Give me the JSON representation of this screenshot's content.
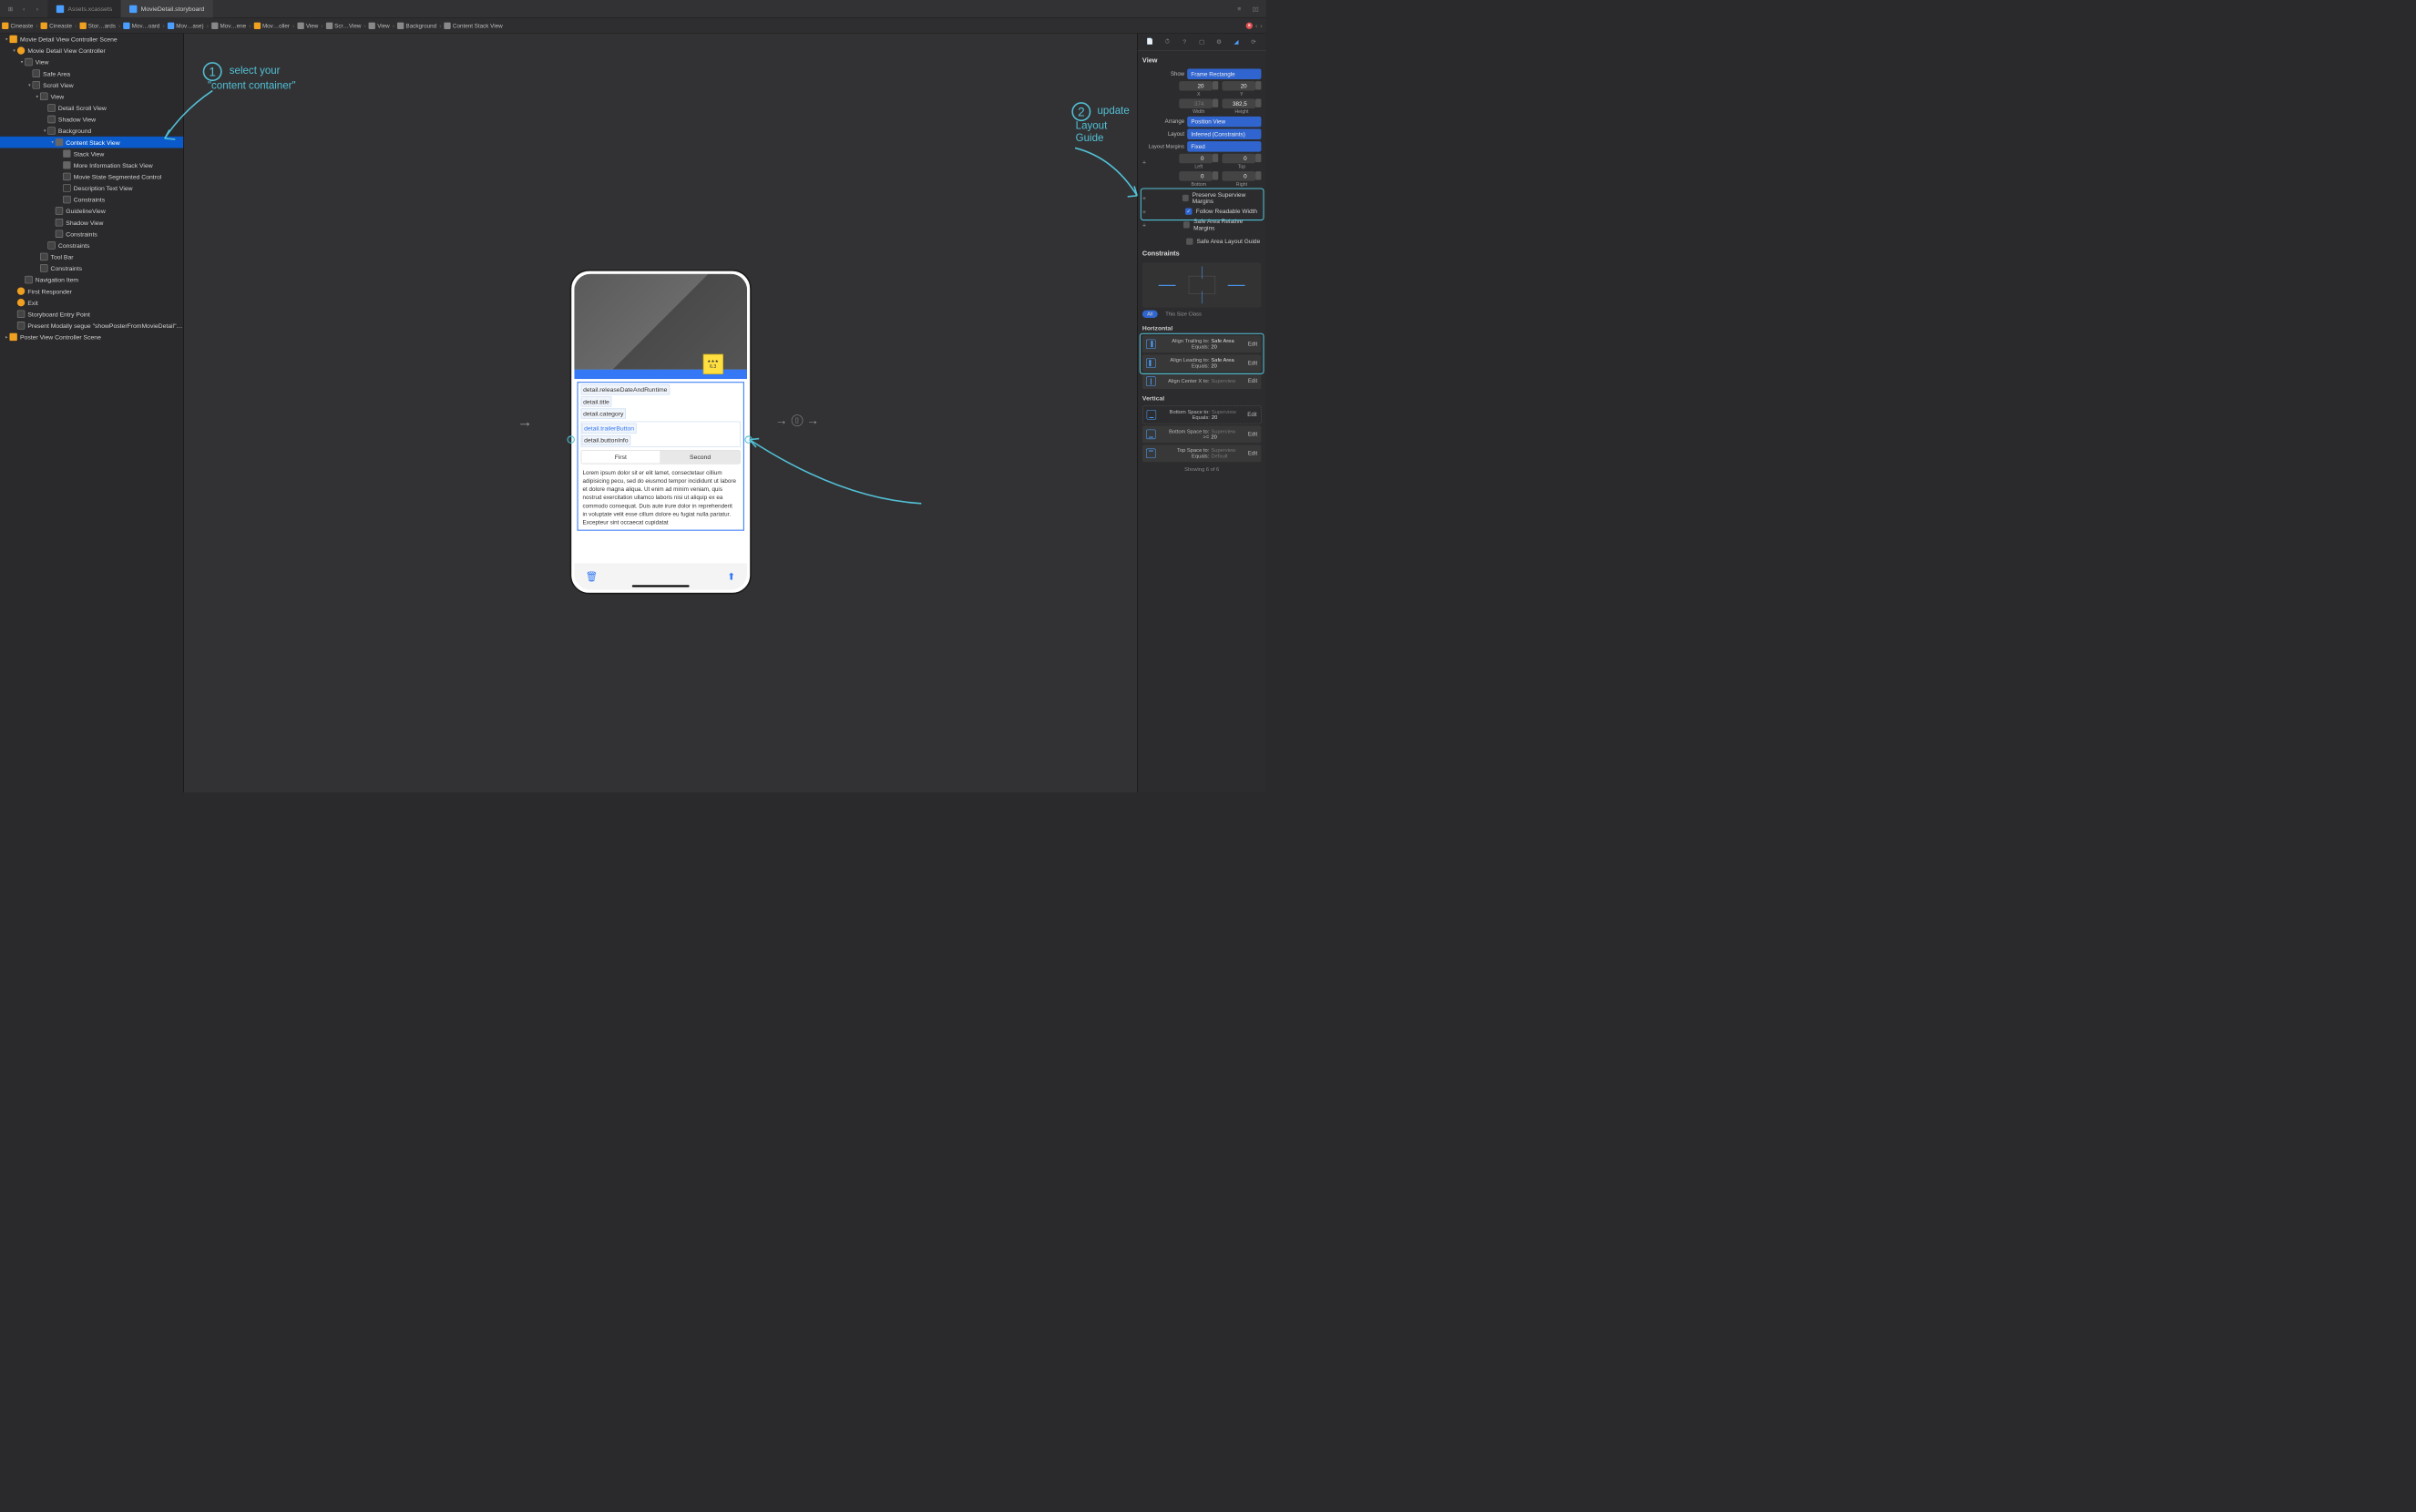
{
  "topbar": {
    "tabs": [
      {
        "label": "Assets.xcassets",
        "active": false
      },
      {
        "label": "MovieDetail.storyboard",
        "active": true
      }
    ]
  },
  "breadcrumb": [
    "Cineaste",
    "Cineaste",
    "Stor…ards",
    "Mov…oard",
    "Mov…ase)",
    "Mov…ene",
    "Mov…oller",
    "View",
    "Scr…View",
    "View",
    "Background",
    "Content Stack View"
  ],
  "outline": [
    {
      "depth": 0,
      "label": "Movie Detail View Controller Scene",
      "icon": "scene",
      "open": true
    },
    {
      "depth": 1,
      "label": "Movie Detail View Controller",
      "icon": "vc",
      "open": true
    },
    {
      "depth": 2,
      "label": "View",
      "icon": "view",
      "open": true
    },
    {
      "depth": 3,
      "label": "Safe Area",
      "icon": "view",
      "leaf": true
    },
    {
      "depth": 3,
      "label": "Scroll View",
      "icon": "view",
      "open": true
    },
    {
      "depth": 4,
      "label": "View",
      "icon": "view",
      "open": true
    },
    {
      "depth": 5,
      "label": "Detail Scroll View",
      "icon": "view",
      "leaf": true
    },
    {
      "depth": 5,
      "label": "Shadow View",
      "icon": "view",
      "leaf": true
    },
    {
      "depth": 5,
      "label": "Background",
      "icon": "view",
      "open": true
    },
    {
      "depth": 6,
      "label": "Content Stack View",
      "icon": "stack",
      "open": true,
      "selected": true
    },
    {
      "depth": 7,
      "label": "Stack View",
      "icon": "stack",
      "leaf": true
    },
    {
      "depth": 7,
      "label": "More Information Stack View",
      "icon": "stack",
      "leaf": true
    },
    {
      "depth": 7,
      "label": "Movie State Segmented Control",
      "icon": "view",
      "leaf": true
    },
    {
      "depth": 7,
      "label": "Description Text View",
      "icon": "text",
      "leaf": true
    },
    {
      "depth": 7,
      "label": "Constraints",
      "icon": "view",
      "leaf": true
    },
    {
      "depth": 6,
      "label": "GuidelineView",
      "icon": "view",
      "leaf": true
    },
    {
      "depth": 6,
      "label": "Shadow View",
      "icon": "view",
      "leaf": true
    },
    {
      "depth": 6,
      "label": "Constraints",
      "icon": "view",
      "leaf": true
    },
    {
      "depth": 5,
      "label": "Constraints",
      "icon": "view",
      "leaf": true
    },
    {
      "depth": 4,
      "label": "Tool Bar",
      "icon": "view",
      "leaf": true
    },
    {
      "depth": 4,
      "label": "Constraints",
      "icon": "view",
      "leaf": true
    },
    {
      "depth": 2,
      "label": "Navigation Item",
      "icon": "view",
      "leaf": true
    },
    {
      "depth": 1,
      "label": "First Responder",
      "icon": "vc",
      "leaf": true
    },
    {
      "depth": 1,
      "label": "Exit",
      "icon": "vc",
      "leaf": true
    },
    {
      "depth": 1,
      "label": "Storyboard Entry Point",
      "icon": "view",
      "leaf": true
    },
    {
      "depth": 1,
      "label": "Present Modally segue \"showPosterFromMovieDetail\"…",
      "icon": "view",
      "leaf": true
    },
    {
      "depth": 0,
      "label": "Poster View Controller Scene",
      "icon": "scene",
      "open": false
    }
  ],
  "canvas": {
    "rating": "6.3",
    "labels": {
      "releaseDate": "detail.releaseDateAndRuntime",
      "title": "detail.title",
      "category": "detail.category",
      "trailer": "detail.trailerButton",
      "buttonInfo": "detail.buttonInfo"
    },
    "segments": [
      "First",
      "Second"
    ],
    "lorem": "Lorem ipsum dolor sit er elit lamet, consectetaur cillium adipisicing pecu, sed do eiusmod tempor incididunt ut labore et dolore magna aliqua. Ut enim ad minim veniam, quis nostrud exercitation ullamco laboris nisi ut aliquip ex ea commodo consequat. Duis aute irure dolor in reprehenderit in voluptate velit esse cillum dolore eu fugiat nulla pariatur. Excepteur sint occaecat cupidatat"
  },
  "inspector": {
    "title": "View",
    "show_label": "Show",
    "show_value": "Frame Rectangle",
    "x": "20",
    "y": "20",
    "xlabel": "X",
    "ylabel": "Y",
    "width": "374",
    "height": "382,5",
    "wlabel": "Width",
    "hlabel": "Height",
    "arrange_label": "Arrange",
    "arrange_value": "Position View",
    "layout_label": "Layout",
    "layout_value": "Inferred (Constraints)",
    "margins_label": "Layout Margins",
    "margins_value": "Fixed",
    "margin_left": "0",
    "margin_top": "0",
    "margin_bottom": "0",
    "margin_right": "0",
    "left_lbl": "Left",
    "top_lbl": "Top",
    "bottom_lbl": "Bottom",
    "right_lbl": "Right",
    "preserve": "Preserve Superview Margins",
    "follow": "Follow Readable Width",
    "safearel": "Safe Area Relative Margins",
    "safeguide": "Safe Area Layout Guide",
    "constraints_title": "Constraints",
    "pill_all": "All",
    "pill_this": "This Size Class",
    "horizontal": "Horizontal",
    "vertical": "Vertical",
    "constraints": {
      "h": [
        {
          "l1": "Align Trailing to:",
          "v1": "Safe Area",
          "l2": "Equals:",
          "v2": "20"
        },
        {
          "l1": "Align Leading to:",
          "v1": "Safe Area",
          "l2": "Equals:",
          "v2": "20"
        },
        {
          "l1": "Align Center X to:",
          "v1": "Superview",
          "dim": true
        }
      ],
      "v": [
        {
          "l1": "Bottom Space to:",
          "v1": "Superview",
          "l2": "Equals:",
          "v2": "20",
          "dim": true
        },
        {
          "l1": "Bottom Space to:",
          "v1": "Superview",
          "l2": ">=",
          "v2": "20",
          "dim": true
        },
        {
          "l1": "Top Space to:",
          "v1": "Superview",
          "l2": "Equals:",
          "v2": "Default",
          "dim": true
        }
      ]
    },
    "edit": "Edit",
    "showing": "Showing 6 of 6"
  },
  "annotations": {
    "a1_text": "select your\n\"content container\"",
    "a2_text": "update\nLayout\nGuide"
  }
}
